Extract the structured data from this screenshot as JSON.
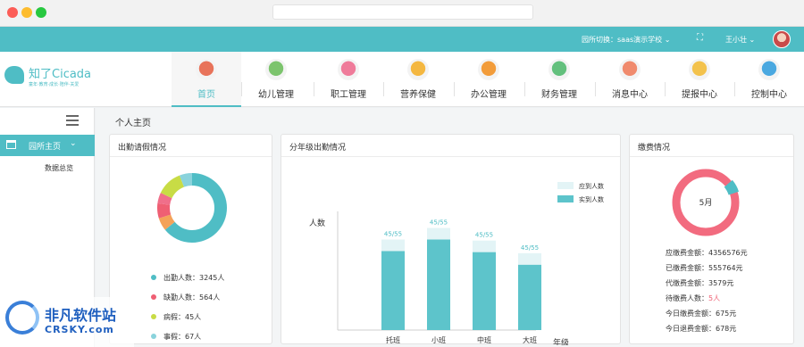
{
  "window": {
    "url": ""
  },
  "topbar": {
    "school_switch": "园所切换：saas演示学校",
    "user_name": "王小壮"
  },
  "brand": {
    "name": "知了Cicada",
    "tagline": "童年·教育·成长·陪伴·关爱"
  },
  "nav": [
    {
      "label": "首页",
      "icon": "home-icon",
      "color": "#e8735a",
      "active": true
    },
    {
      "label": "幼儿管理",
      "icon": "child-icon",
      "color": "#7cc46d",
      "active": false
    },
    {
      "label": "职工管理",
      "icon": "staff-icon",
      "color": "#ef7b9a",
      "active": false
    },
    {
      "label": "营养保健",
      "icon": "health-icon",
      "color": "#f4b740",
      "active": false
    },
    {
      "label": "办公管理",
      "icon": "office-icon",
      "color": "#f29c3a",
      "active": false
    },
    {
      "label": "财务管理",
      "icon": "finance-icon",
      "color": "#63c07d",
      "active": false
    },
    {
      "label": "消息中心",
      "icon": "message-icon",
      "color": "#f08a6d",
      "active": false
    },
    {
      "label": "提报中心",
      "icon": "report-icon",
      "color": "#f3c24c",
      "active": false
    },
    {
      "label": "控制中心",
      "icon": "control-icon",
      "color": "#4aa8e0",
      "active": false
    }
  ],
  "sidebar": {
    "main_label": "园所主页",
    "sub_label": "数据总览"
  },
  "page_title": "个人主页",
  "attendance": {
    "title": "出勤请假情况",
    "items": [
      {
        "label": "出勤人数：3245人",
        "value": 3245,
        "color": "#4fbdc5"
      },
      {
        "label": "缺勤人数：564人",
        "value": 564,
        "color": "#ef5f73"
      },
      {
        "label": "病假：45人",
        "value": 45,
        "color": "#c8dc45"
      },
      {
        "label": "事假：67人",
        "value": 67,
        "color": "#8ad3dc"
      }
    ],
    "ring_segments": [
      {
        "color": "#4fbdc5",
        "fraction": 0.64
      },
      {
        "color": "#f4a259",
        "fraction": 0.06
      },
      {
        "color": "#ef5f73",
        "fraction": 0.07
      },
      {
        "color": "#f06f8a",
        "fraction": 0.05
      },
      {
        "color": "#c8dc45",
        "fraction": 0.12
      },
      {
        "color": "#8ad3dc",
        "fraction": 0.06
      }
    ]
  },
  "grade_attendance": {
    "title": "分年级出勤情况",
    "chart_data": {
      "type": "bar",
      "ylabel": "人数",
      "xlabel": "年级",
      "categories": [
        "托班",
        "小班",
        "中班",
        "大班"
      ],
      "series": [
        {
          "name": "应到人数",
          "values": [
            55,
            55,
            55,
            55
          ],
          "color": "#e3f4f6"
        },
        {
          "name": "实到人数",
          "values": [
            45,
            45,
            45,
            45
          ],
          "color": "#5dc4cb"
        }
      ],
      "data_labels": [
        "45/55",
        "45/55",
        "45/55",
        "45/55"
      ],
      "relative_heights": [
        0.75,
        0.86,
        0.74,
        0.62
      ],
      "legend_position": "top-right"
    }
  },
  "fees": {
    "title": "缴费情况",
    "ring_label": "5月",
    "ring_paid_fraction": 0.94,
    "ring_colors": {
      "main": "#f26b7f",
      "accent": "#4fbdc5"
    },
    "rows": [
      {
        "label": "应缴费金额：",
        "value": "4356576元",
        "highlight": false
      },
      {
        "label": "已缴费金额：",
        "value": "555764元",
        "highlight": false
      },
      {
        "label": "代缴费金额：",
        "value": "3579元",
        "highlight": false
      },
      {
        "label": "待缴费人数：",
        "value": "5人",
        "highlight": true
      },
      {
        "label": "今日缴费金额：",
        "value": "675元",
        "highlight": false
      },
      {
        "label": "今日退费金额：",
        "value": "678元",
        "highlight": false
      }
    ]
  },
  "watermark": {
    "cn": "非凡软件站",
    "en": "CRSKY.com"
  }
}
